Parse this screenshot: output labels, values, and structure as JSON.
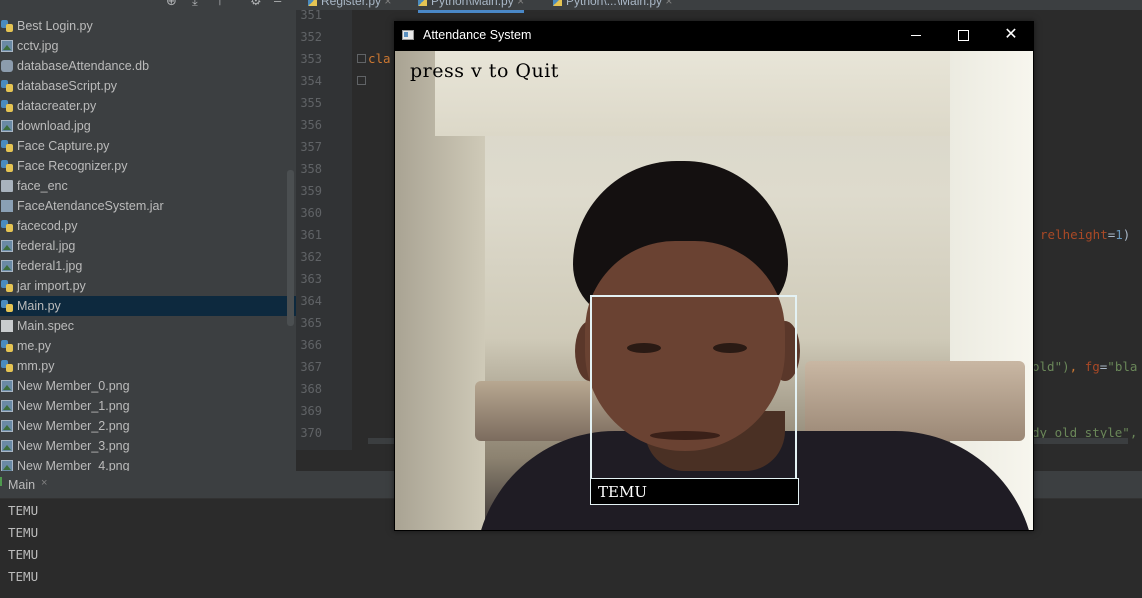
{
  "project_tree": {
    "items": [
      {
        "label": "Best Login.py",
        "icon": "python-file-icon"
      },
      {
        "label": "cctv.jpg",
        "icon": "image-file-icon"
      },
      {
        "label": "databaseAttendance.db",
        "icon": "database-file-icon"
      },
      {
        "label": "databaseScript.py",
        "icon": "python-file-icon"
      },
      {
        "label": "datacreater.py",
        "icon": "python-file-icon"
      },
      {
        "label": "download.jpg",
        "icon": "image-file-icon"
      },
      {
        "label": "Face Capture.py",
        "icon": "python-file-icon"
      },
      {
        "label": "Face Recognizer.py",
        "icon": "python-file-icon"
      },
      {
        "label": "face_enc",
        "icon": "file-icon"
      },
      {
        "label": "FaceAtendanceSystem.jar",
        "icon": "jar-file-icon"
      },
      {
        "label": "facecod.py",
        "icon": "python-file-icon"
      },
      {
        "label": "federal.jpg",
        "icon": "image-file-icon"
      },
      {
        "label": "federal1.jpg",
        "icon": "image-file-icon"
      },
      {
        "label": "jar import.py",
        "icon": "python-file-icon"
      },
      {
        "label": "Main.py",
        "icon": "python-file-icon",
        "selected": true
      },
      {
        "label": "Main.spec",
        "icon": "spec-file-icon"
      },
      {
        "label": "me.py",
        "icon": "python-file-icon"
      },
      {
        "label": "mm.py",
        "icon": "python-file-icon"
      },
      {
        "label": "New Member_0.png",
        "icon": "image-file-icon"
      },
      {
        "label": "New Member_1.png",
        "icon": "image-file-icon"
      },
      {
        "label": "New Member_2.png",
        "icon": "image-file-icon"
      },
      {
        "label": "New Member_3.png",
        "icon": "image-file-icon"
      },
      {
        "label": "New Member_4.png",
        "icon": "image-file-icon"
      }
    ]
  },
  "editor": {
    "tabs": [
      {
        "label": "Register.py"
      },
      {
        "label": "Python\\Main.py",
        "active": true
      },
      {
        "label": "Python\\...\\Main.py"
      }
    ],
    "line_numbers": [
      "351",
      "352",
      "353",
      "354",
      "355",
      "356",
      "357",
      "358",
      "359",
      "360",
      "361",
      "362",
      "363",
      "364",
      "365",
      "366",
      "367",
      "368",
      "369",
      "370"
    ],
    "code_fragments": {
      "line353": "cla",
      "line361_kw": "relheight",
      "line361_eq": "=",
      "line361_num": "1",
      "line361_end": ")",
      "line367_str": "old\")",
      "line367_sep": ", ",
      "line367_kw": "fg",
      "line367_eq": "=",
      "line367_str2": "\"bla",
      "line370_str": "dy old style\","
    }
  },
  "run_panel": {
    "tab_label": "Main",
    "close_glyph": "×",
    "output_lines": [
      "TEMU",
      "TEMU",
      "TEMU",
      "TEMU"
    ]
  },
  "attendance_window": {
    "title": "Attendance System",
    "minimize_label": "",
    "maximize_label": "",
    "close_label": "✕",
    "overlay_text": "press v to Quit",
    "detected_name": "TEMU"
  },
  "colors": {
    "tree_bg": "#3c3f41",
    "editor_bg": "#2b2b2b",
    "selection": "#0d293e",
    "keyword_orange": "#cc7832",
    "string_green": "#6a8759",
    "number_blue": "#6897bb",
    "param_purple": "#aa4926",
    "face_box": "#e4f2f4"
  }
}
